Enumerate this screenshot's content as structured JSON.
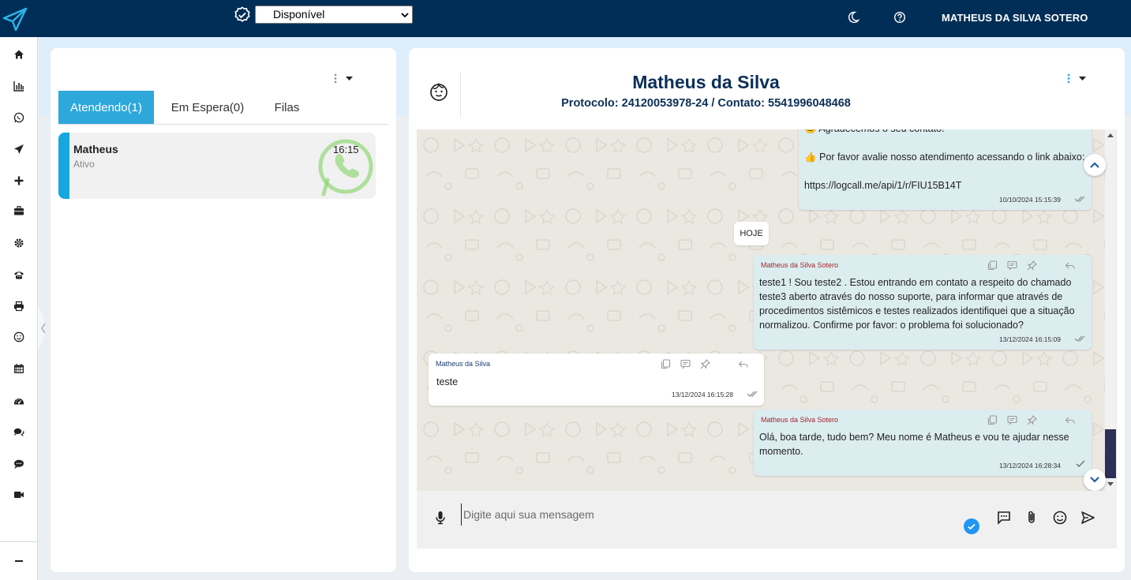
{
  "header": {
    "status_options": [
      "Disponível"
    ],
    "status_value": "Disponível",
    "user_name": "MATHEUS DA SILVA SOTERO"
  },
  "sidebar": {
    "items": [
      "home-icon",
      "chart-icon",
      "whatsapp-icon",
      "send-icon",
      "plus-icon",
      "briefcase-icon",
      "gear-icon",
      "phone-icon",
      "printer-icon",
      "smile-icon",
      "calendar-icon",
      "dashboard-icon",
      "comments-icon",
      "comment-dots-icon",
      "video-icon"
    ],
    "bottom": "minus-icon"
  },
  "left_panel": {
    "tabs": [
      {
        "label": "Atendendo(1)",
        "active": true
      },
      {
        "label": "Em Espera(0)",
        "active": false
      },
      {
        "label": "Filas",
        "active": false
      }
    ],
    "chats": [
      {
        "name": "Matheus",
        "status": "Ativo",
        "time": "16:15",
        "channel_icon": "whatsapp-icon"
      }
    ]
  },
  "right_panel": {
    "contact_name": "Matheus da Silva",
    "protocol_line": "Protocolo: 24120053978-24 / Contato: 5541996048468",
    "messages": [
      {
        "direction": "out",
        "sender": "",
        "lines": [
          "😊 Agradecemos o seu contato!",
          "",
          "👍 Por favor avalie nosso atendimento acessando o link abaixo:",
          "",
          "https://logcall.me/api/1/r/FIU15B14T"
        ],
        "time": "10/10/2024 15:15:39",
        "read": true
      },
      {
        "direction": "out",
        "sender": "Matheus da Silva Sotero",
        "lines": [
          " teste1 ! Sou teste2 . Estou entrando em contato a respeito do chamado",
          "teste3 aberto através do nosso suporte, para informar que através de",
          "procedimentos sistêmicos e testes realizados identifiquei que a situação",
          "normalizou. Confirme por favor: o problema foi solucionado?"
        ],
        "time": "13/12/2024 16:15:09",
        "read": true
      },
      {
        "direction": "in",
        "sender": "Matheus da Silva",
        "lines": [
          "teste"
        ],
        "time": "13/12/2024 16:15:28",
        "read": true
      },
      {
        "direction": "out",
        "sender": "Matheus da Silva Sotero",
        "lines": [
          " Olá, boa tarde, tudo bem? Meu nome é Matheus e vou te ajudar nesse",
          "momento."
        ],
        "time": "13/12/2024 16:28:34",
        "read": false
      }
    ],
    "date_separator": "HOJE",
    "composer": {
      "placeholder": "Digite aqui sua mensagem",
      "value": ""
    }
  },
  "colors": {
    "topbar": "#012e56",
    "accent": "#2ea7db",
    "outgoing_bubble": "#dcedf0",
    "sender_out": "#a3262a",
    "sender_in": "#1a3b72"
  }
}
